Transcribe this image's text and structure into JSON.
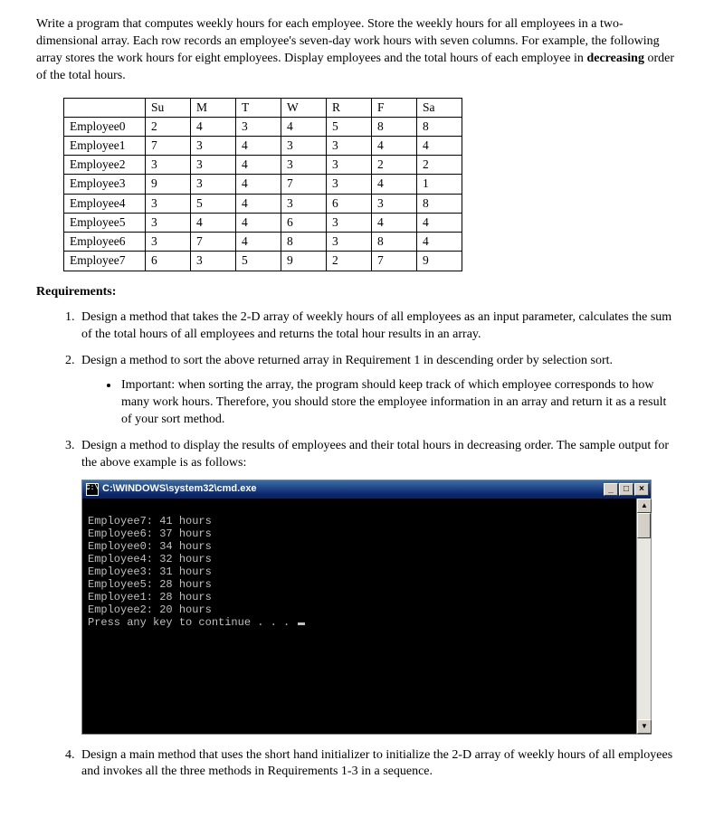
{
  "intro": "Write a program that computes weekly hours for each employee.  Store the weekly hours for all employees in a two-dimensional array.  Each row records an employee's seven-day work hours with seven columns.  For example, the following array stores the work hours for eight employees.  Display employees and the total hours of each employee in ",
  "intro_bold": "decreasing",
  "intro_tail": " order of the total hours.",
  "table": {
    "headers": [
      "",
      "Su",
      "M",
      "T",
      "W",
      "R",
      "F",
      "Sa"
    ],
    "rows": [
      [
        "Employee0",
        "2",
        "4",
        "3",
        "4",
        "5",
        "8",
        "8"
      ],
      [
        "Employee1",
        "7",
        "3",
        "4",
        "3",
        "3",
        "4",
        "4"
      ],
      [
        "Employee2",
        "3",
        "3",
        "4",
        "3",
        "3",
        "2",
        "2"
      ],
      [
        "Employee3",
        "9",
        "3",
        "4",
        "7",
        "3",
        "4",
        "1"
      ],
      [
        "Employee4",
        "3",
        "5",
        "4",
        "3",
        "6",
        "3",
        "8"
      ],
      [
        "Employee5",
        "3",
        "4",
        "4",
        "6",
        "3",
        "4",
        "4"
      ],
      [
        "Employee6",
        "3",
        "7",
        "4",
        "8",
        "3",
        "8",
        "4"
      ],
      [
        "Employee7",
        "6",
        "3",
        "5",
        "9",
        "2",
        "7",
        "9"
      ]
    ]
  },
  "requirements_title": "Requirements:",
  "req1": "Design a method that takes the 2-D array of weekly hours of all employees as an input parameter, calculates the sum of the total hours of all employees and returns the total hour results in an array.",
  "req2": "Design a method to sort the above returned array in Requirement 1 in descending order by selection sort.",
  "req2_bullet": "Important: when sorting the array, the program should keep track of which employee corresponds to how many work hours. Therefore, you should store the employee information in an array and return it as a result of your sort method.",
  "req3": "Design a method to display the results of employees and their total hours in decreasing order.  The sample output for the above example is as follows:",
  "console_title": "C:\\WINDOWS\\system32\\cmd.exe",
  "console_lines": [
    "",
    "Employee7: 41 hours",
    "Employee6: 37 hours",
    "Employee0: 34 hours",
    "Employee4: 32 hours",
    "Employee3: 31 hours",
    "Employee5: 28 hours",
    "Employee1: 28 hours",
    "Employee2: 20 hours",
    "Press any key to continue . . . "
  ],
  "win_btn_min": "_",
  "win_btn_max": "□",
  "win_btn_close": "×",
  "sb_up": "▲",
  "sb_down": "▼",
  "cmd_icon_text": "C:\\",
  "req4": "Design a main method that uses the short hand initializer to initialize the 2-D array of weekly hours of all employees and invokes all the three methods in Requirements 1-3 in a sequence."
}
